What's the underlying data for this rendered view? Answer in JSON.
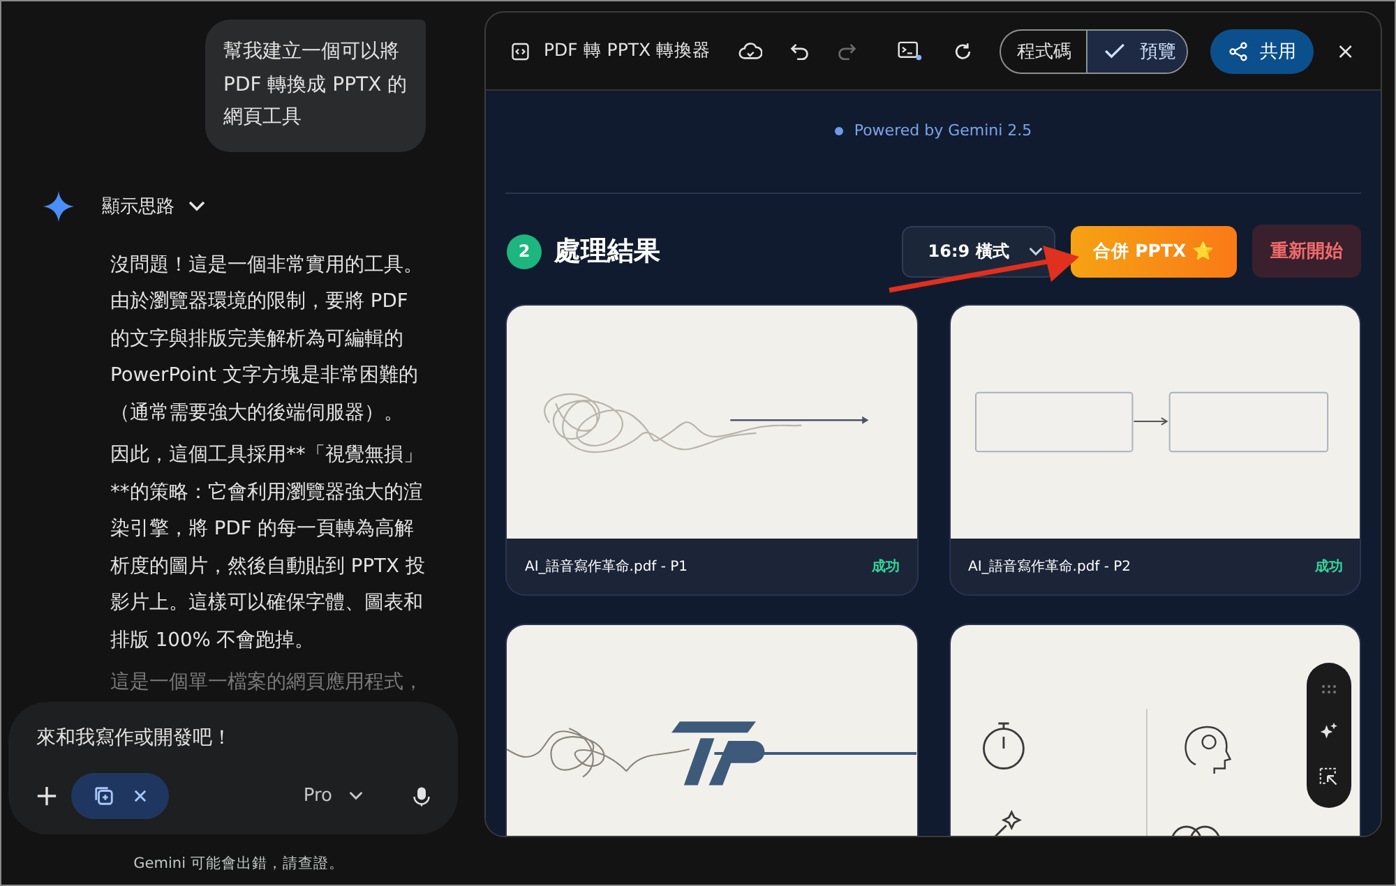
{
  "chat": {
    "user_message": "幫我建立一個可以將 PDF 轉換成 PPTX 的網頁工具",
    "thinking_toggle": {
      "label": "顯示思路",
      "expanded": false
    },
    "paragraphs": [
      "沒問題！這是一個非常實用的工具。由於瀏覽器環境的限制，要將 PDF 的文字與排版完美解析為可編輯的 PowerPoint 文字方塊是非常困難的（通常需要強大的後端伺服器）。",
      "因此，這個工具採用**「視覺無損」**的策略：它會利用瀏覽器強大的渲染引擎，將 PDF 的每一頁轉為高解析度的圖片，然後自動貼到 PPTX 投影片上。這樣可以確保字體、圖表和排版 100% 不會跑掉。"
    ],
    "faded_paragraph": "這是一個單一檔案的網頁應用程式，"
  },
  "composer": {
    "placeholder": "來和我寫作或開發吧！",
    "model": "Pro"
  },
  "disclaimer": "Gemini 可能會出錯，請查證。",
  "canvas": {
    "title": "PDF 轉 PPTX 轉換器",
    "view_tabs": [
      {
        "label": "程式碼",
        "selected": false
      },
      {
        "label": "預覽",
        "selected": true
      }
    ],
    "share_label": "共用",
    "powered_by": "Powered by Gemini 2.5",
    "step": {
      "number": "2",
      "title": "處理結果"
    },
    "layout_select": "16:9 橫式",
    "merge_button": "合併 PPTX ⭐",
    "restart_button": "重新開始",
    "results": [
      {
        "kind": "scribble-arrow",
        "name": "AI_語音寫作革命.pdf - P1",
        "status": "成功"
      },
      {
        "kind": "flow-boxes",
        "name": "AI_語音寫作革命.pdf - P2",
        "status": "成功"
      },
      {
        "kind": "logo-line"
      },
      {
        "kind": "icon-grid"
      }
    ]
  }
}
